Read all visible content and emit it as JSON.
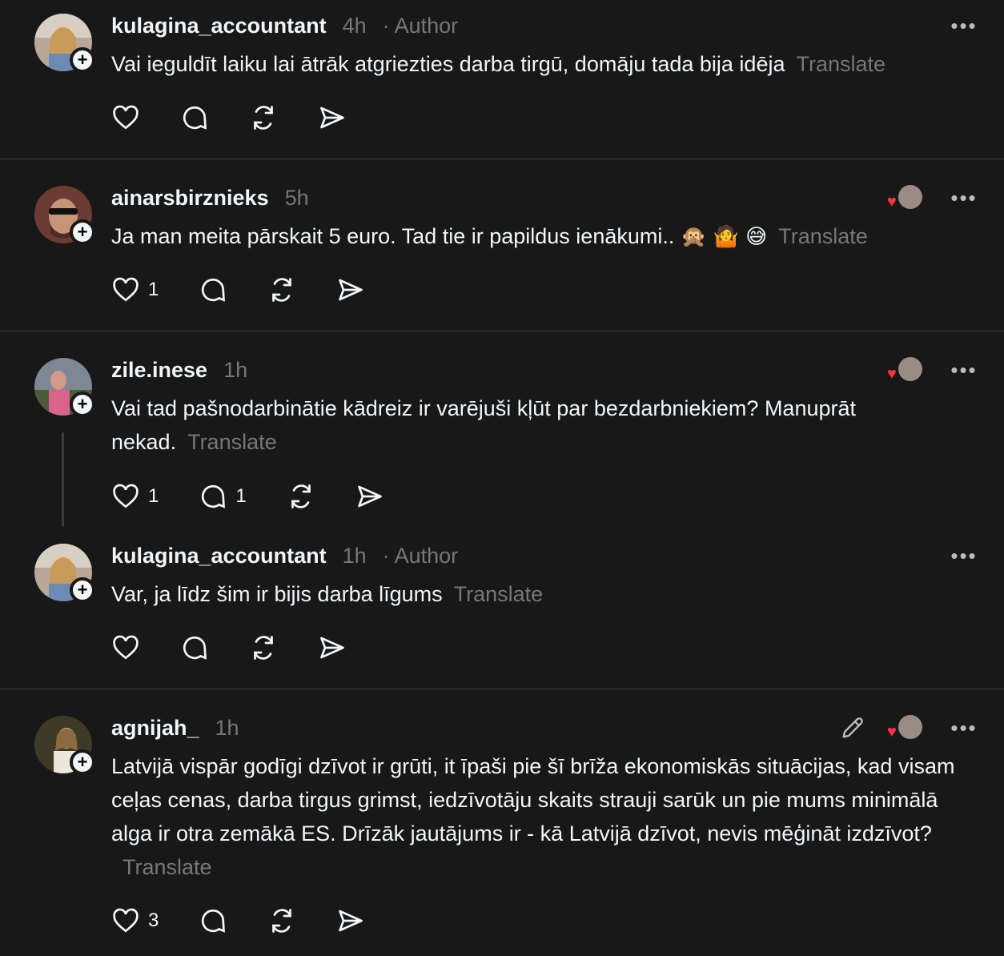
{
  "posts": [
    {
      "username": "kulagina_accountant",
      "time": "4h",
      "author": "· Author",
      "text": "Vai ieguldīt laiku lai ātrāk atgriezties darba tirgū, domāju tada bija idēja",
      "translate": "Translate",
      "like_count": "",
      "reply_count": ""
    },
    {
      "username": "ainarsbirznieks",
      "time": "5h",
      "text": "Ja man meita pārskait 5 euro. Tad tie ir papildus ienākumi..",
      "emojis": [
        "🙊",
        "🤷",
        "😅"
      ],
      "translate": "Translate",
      "like_count": "1",
      "reply_count": ""
    },
    {
      "username": "zile.inese",
      "time": "1h",
      "text": "Vai tad pašnodarbinātie kādreiz ir varējuši kļūt par bezdarbniekiem? Manuprāt nekad.",
      "translate": "Translate",
      "like_count": "1",
      "reply_count": "1"
    },
    {
      "username": "kulagina_accountant",
      "time": "1h",
      "author": "· Author",
      "text": "Var, ja līdz šim ir bijis darba līgums",
      "translate": "Translate",
      "like_count": "",
      "reply_count": ""
    },
    {
      "username": "agnijah_",
      "time": "1h",
      "text": "Latvijā vispār godīgi dzīvot ir grūti, it īpaši pie šī brīža ekonomiskās situācijas, kad visam ceļas cenas, darba tirgus grimst, iedzīvotāju skaits strauji sarūk un pie mums minimālā alga ir otra zemākā ES. Drīzāk jautājums ir - kā Latvijā dzīvot, nevis mēģināt izdzīvot?",
      "translate": "Translate",
      "like_count": "3",
      "reply_count": ""
    }
  ],
  "icons": {
    "like": "heart-icon",
    "reply": "comment-icon",
    "repost": "repost-icon",
    "share": "send-icon",
    "more": "more-icon",
    "follow": "plus-icon",
    "edit": "pencil-icon"
  },
  "colors": {
    "background": "#181818",
    "text": "#f3f5f7",
    "secondary": "#777777",
    "divider": "#333638",
    "like_heart": "#ff3040"
  }
}
